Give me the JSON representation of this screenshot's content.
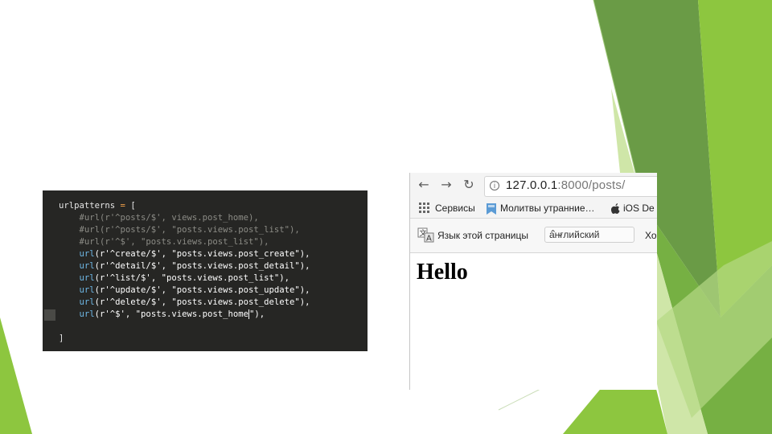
{
  "colors": {
    "green_dark": "#5a8a3a",
    "green_mid": "#76b043",
    "green_light": "#8dc63f",
    "green_pale": "#cfe6a8",
    "code_background": "#262624"
  },
  "code": {
    "lines": [
      [
        {
          "t": "urlpatterns ",
          "c": "kw"
        },
        {
          "t": "=",
          "c": "op"
        },
        {
          "t": " [",
          "c": "kw"
        }
      ],
      [
        {
          "t": "    #url(r'^posts/$', views.post_home),",
          "c": "cm"
        }
      ],
      [
        {
          "t": "    #url(r'^posts/$', \"posts.views.post_list\"),",
          "c": "cm"
        }
      ],
      [
        {
          "t": "    #url(r'^$', \"posts.views.post_list\"),",
          "c": "cm"
        }
      ],
      [
        {
          "t": "    url",
          "c": "fn"
        },
        {
          "t": "(r'^create/$', \"posts.views.post_create\"),",
          "c": "st"
        }
      ],
      [
        {
          "t": "    url",
          "c": "fn"
        },
        {
          "t": "(r'^detail/$', \"posts.views.post_detail\"),",
          "c": "st"
        }
      ],
      [
        {
          "t": "    url",
          "c": "fn"
        },
        {
          "t": "(r'^list/$', \"posts.views.post_list\"),",
          "c": "st"
        }
      ],
      [
        {
          "t": "    url",
          "c": "fn"
        },
        {
          "t": "(r'^update/$', \"posts.views.post_update\"),",
          "c": "st"
        }
      ],
      [
        {
          "t": "    url",
          "c": "fn"
        },
        {
          "t": "(r'^delete/$', \"posts.views.post_delete\"),",
          "c": "st"
        }
      ],
      [
        {
          "t": "    url",
          "c": "fn"
        },
        {
          "t": "(r'^$', \"posts.views.post_home",
          "c": "st"
        },
        {
          "t": "CURSOR",
          "c": "cursor"
        },
        {
          "t": "\"),",
          "c": "st"
        }
      ],
      [
        {
          "t": "",
          "c": "kw"
        }
      ],
      [
        {
          "t": "]",
          "c": "kw"
        }
      ]
    ]
  },
  "browser": {
    "nav": {
      "back_icon": "arrow-left-icon",
      "forward_icon": "arrow-right-icon",
      "reload_icon": "reload-icon"
    },
    "address": {
      "host": "127.0.0.1",
      "rest": ":8000/posts/"
    },
    "bookmarks": [
      {
        "label": "Сервисы",
        "icon": "apps-grid-icon"
      },
      {
        "label": "Молитвы утранние…",
        "icon": "bookmark-favicon-icon"
      },
      {
        "label": "iOS De",
        "icon": "apple-icon"
      }
    ],
    "translate": {
      "message": "Язык этой страницы",
      "language": "английский",
      "more": "Хо"
    },
    "page": {
      "heading": "Hello"
    }
  }
}
